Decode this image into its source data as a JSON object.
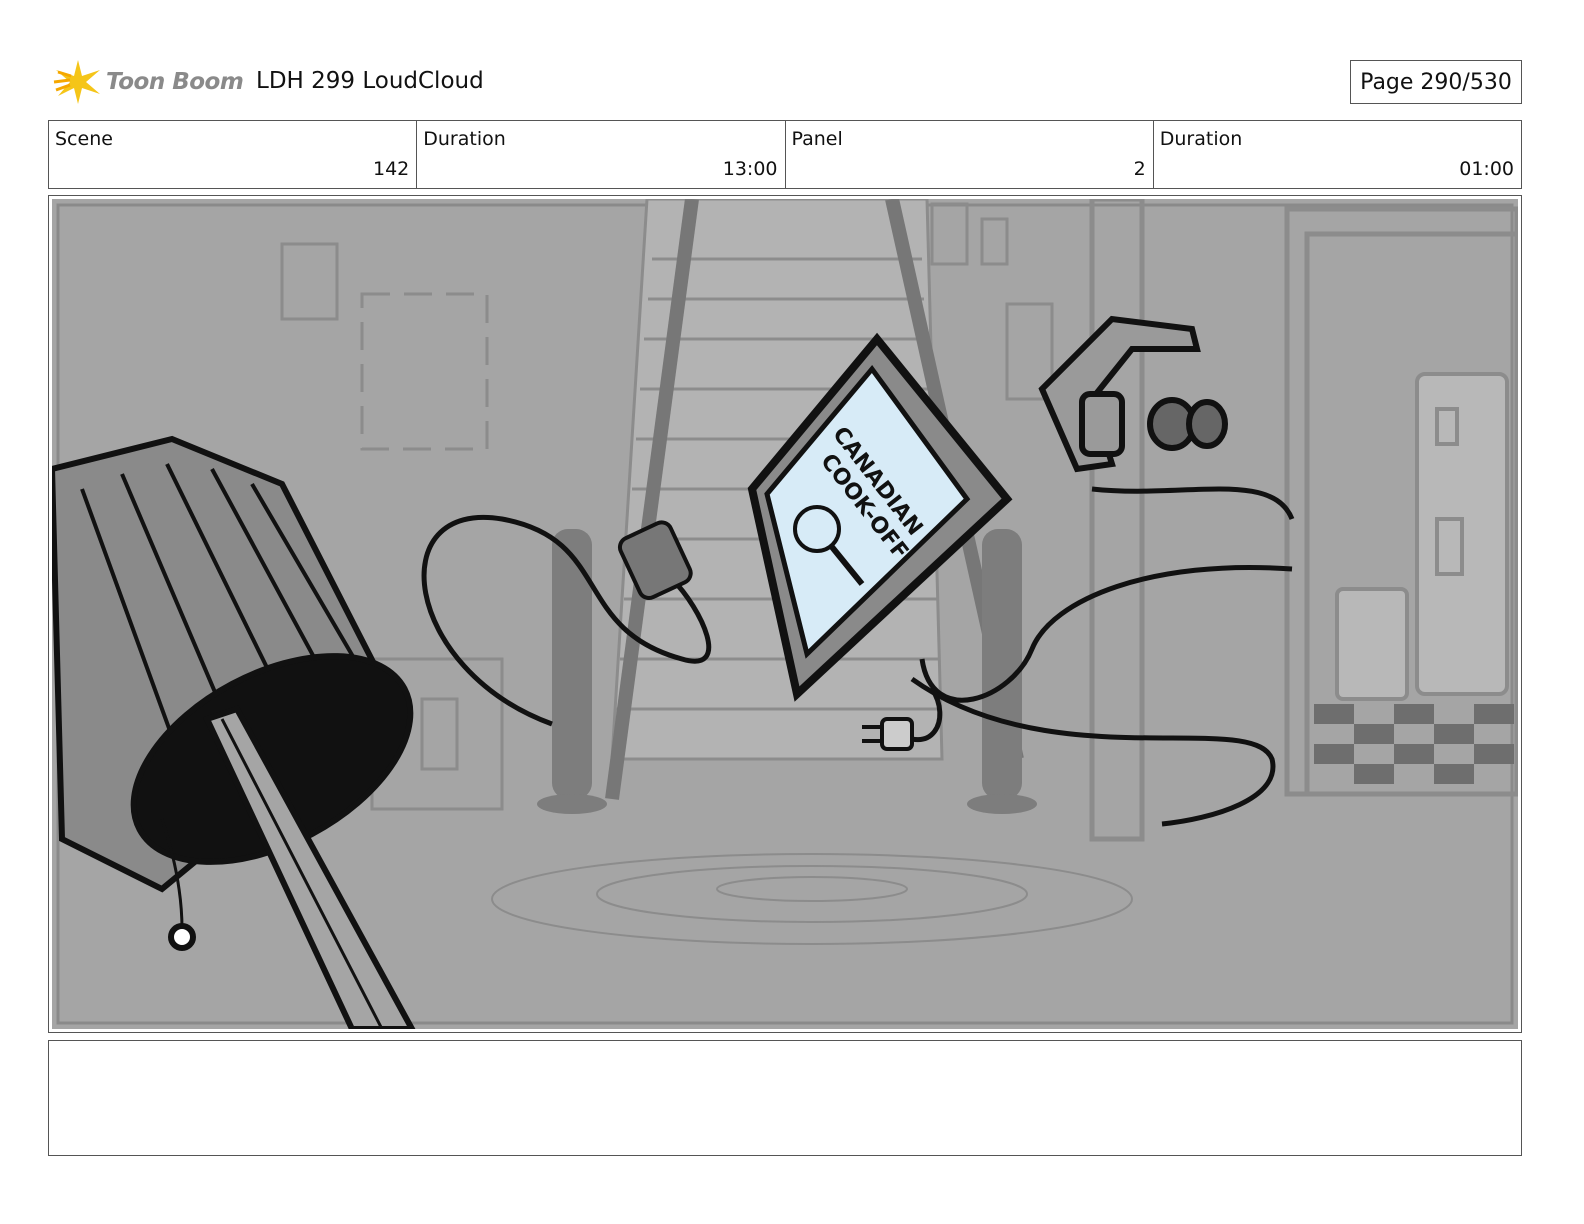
{
  "header": {
    "brand_name": "Toon Boom",
    "project_title": "LDH 299 LoudCloud",
    "page_label": "Page 290/530"
  },
  "info": {
    "scene_label": "Scene",
    "scene_value": "142",
    "scene_duration_label": "Duration",
    "scene_duration_value": "13:00",
    "panel_label": "Panel",
    "panel_value": "2",
    "panel_duration_label": "Duration",
    "panel_duration_value": "01:00"
  },
  "panel": {
    "tv_text_line1": "CANADIAN",
    "tv_text_line2": "COOK-OFF"
  },
  "notes": {
    "text": ""
  },
  "colors": {
    "logo_yellow": "#f5c518",
    "panel_gray": "#a5a5a5",
    "tv_screen": "#d7ebf7"
  }
}
